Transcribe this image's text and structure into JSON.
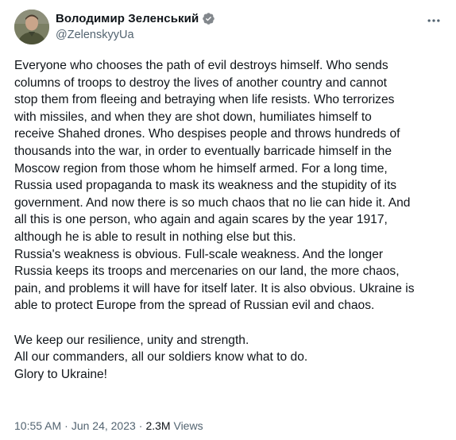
{
  "author": {
    "display_name": "Володимир Зеленський",
    "handle": "@ZelenskyyUa",
    "verified": true
  },
  "tweet": {
    "text": "Everyone who chooses the path of evil destroys himself. Who sends\ncolumns of troops to destroy the lives of another country and cannot\nstop them from fleeing and betraying when life resists. Who terrorizes\nwith missiles, and when they are shot down, humiliates himself to\nreceive Shahed drones. Who despises people and throws hundreds of\nthousands into the war, in order to eventually barricade himself in the\nMoscow region from those whom he himself armed. For a long time,\nRussia used propaganda to mask its weakness and the stupidity of its\ngovernment. And now there is so much chaos that no lie can hide it. And\nall this is one person, who again and again scares by the year 1917,\nalthough he is able to result in nothing else but this.\nRussia's weakness is obvious. Full-scale weakness. And the longer\nRussia keeps its troops and mercenaries on our land, the more chaos,\npain, and problems it will have for itself later. It is also obvious. Ukraine is\nable to protect Europe from the spread of Russian evil and chaos.\n\nWe keep our resilience, unity and strength.\nAll our commanders, all our soldiers know what to do.\nGlory to Ukraine!",
    "time": "10:55 AM",
    "separator": "·",
    "date": "Jun 24, 2023",
    "views_count": "2.3M",
    "views_label": "Views"
  },
  "icons": {
    "verified": "verified-badge-icon",
    "more": "more-options-icon"
  },
  "colors": {
    "text": "#0f1419",
    "secondary": "#536471",
    "verified_badge": "#1d9bf0",
    "background": "#ffffff"
  }
}
